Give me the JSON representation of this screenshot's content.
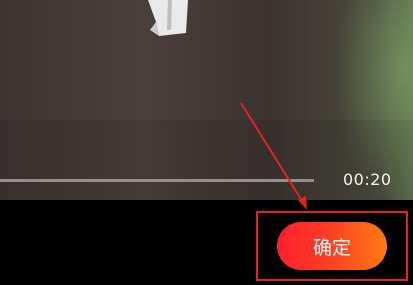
{
  "video": {
    "elapsed_time": "00:20"
  },
  "actions": {
    "confirm_label": "确定"
  },
  "colors": {
    "annotation": "#e3231c",
    "button_gradient_start": "#ff1f2e",
    "button_gradient_end": "#ff7a12"
  },
  "icons": {
    "annotation": "annotation-arrow-icon"
  }
}
